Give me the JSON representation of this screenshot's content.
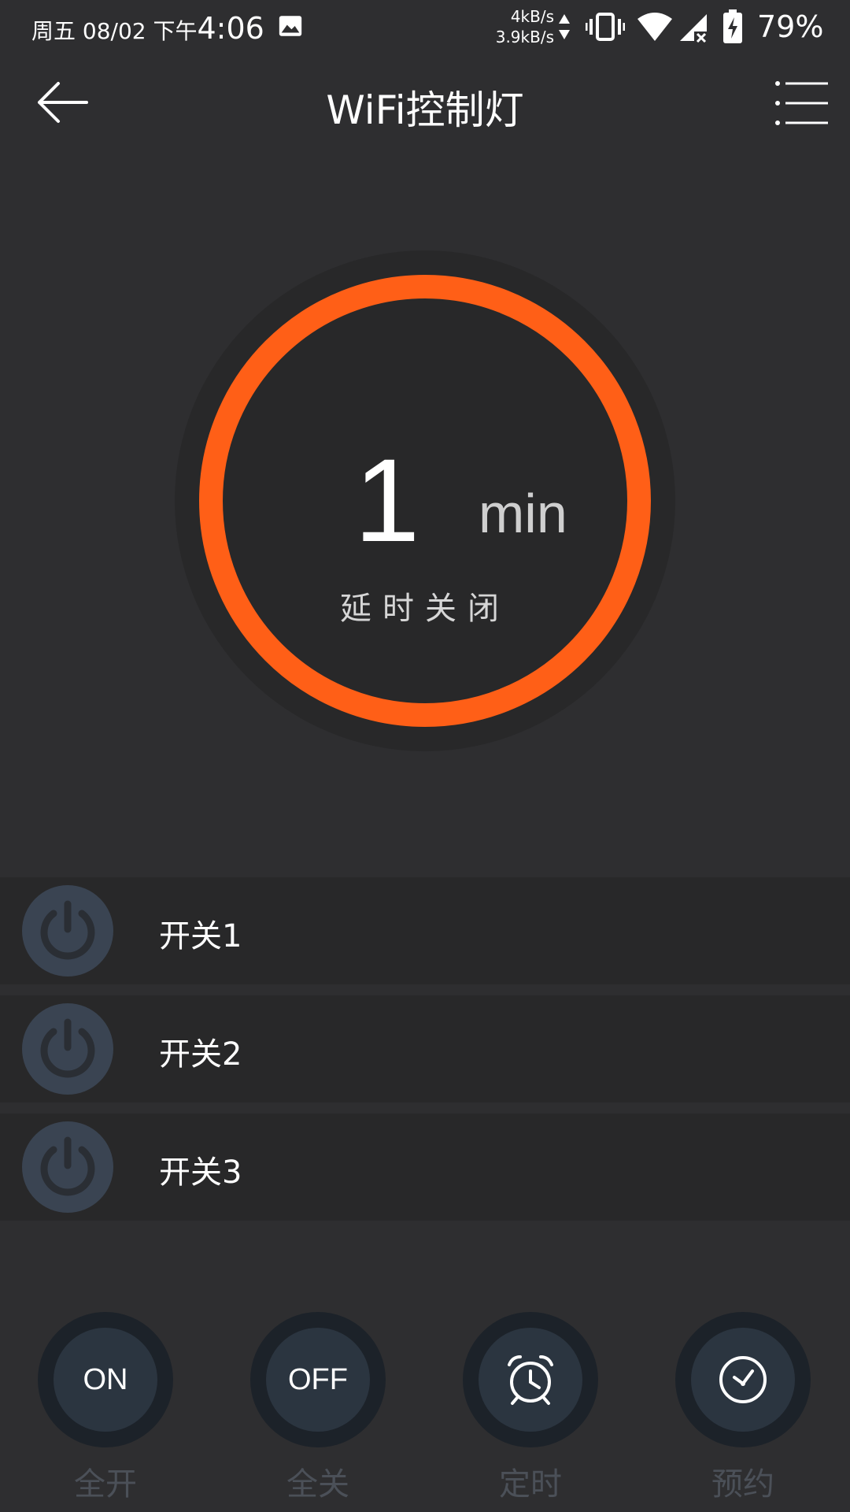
{
  "status_bar": {
    "date": "周五 08/02 下午",
    "time": "4:06",
    "speed_up": "4kB/s",
    "speed_down": "3.9kB/s",
    "battery": "79%"
  },
  "header": {
    "title": "WiFi控制灯"
  },
  "gauge": {
    "value": "1",
    "unit": "min",
    "label": "延时关闭",
    "ring_color": "#ff5f17"
  },
  "switches": [
    {
      "label": "开关1"
    },
    {
      "label": "开关2"
    },
    {
      "label": "开关3"
    }
  ],
  "bottom_buttons": [
    {
      "icon_text": "ON",
      "caption": "全开"
    },
    {
      "icon_text": "OFF",
      "caption": "全关"
    },
    {
      "icon": "alarm-clock-icon",
      "caption": "定时"
    },
    {
      "icon": "clock-icon",
      "caption": "预约"
    }
  ],
  "colors": {
    "background": "#2e2e30",
    "row_background": "#282829",
    "accent": "#ff5f17",
    "power_icon": "#3a4452"
  }
}
